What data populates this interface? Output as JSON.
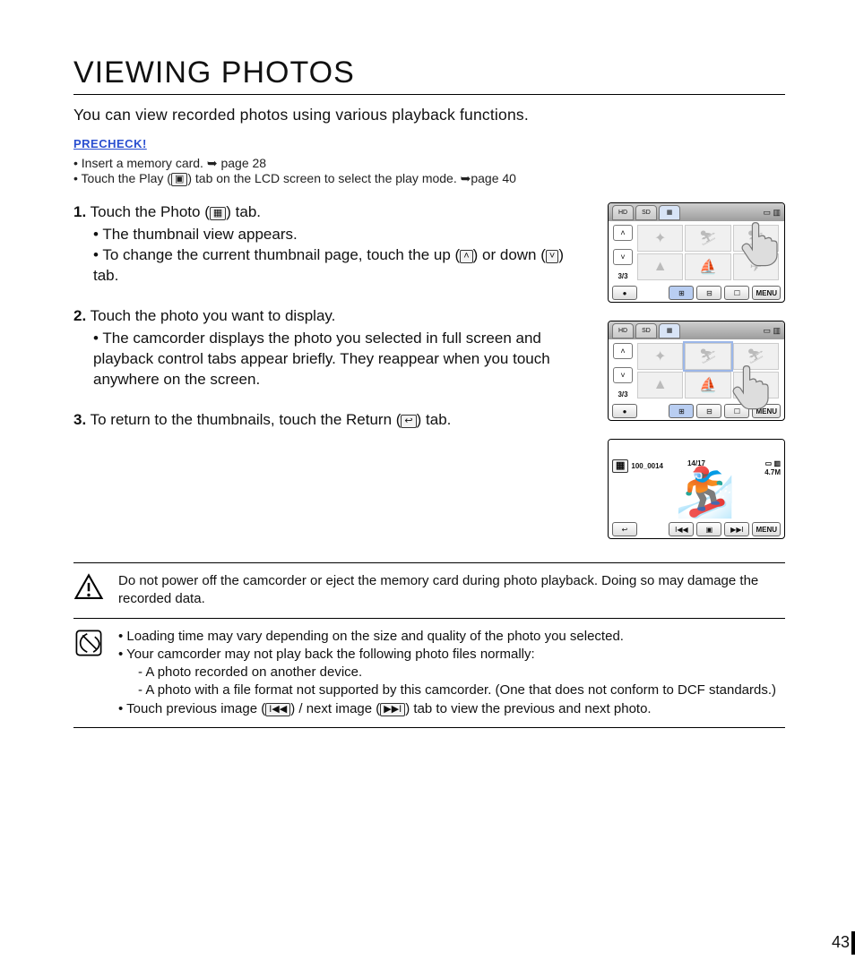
{
  "title": "VIEWING PHOTOS",
  "intro": "You can view recorded photos using various playback functions.",
  "precheck": {
    "label": "PRECHECK!",
    "items": [
      {
        "text": "Insert a memory card. ",
        "arrow": "➥",
        "ref": "page 28"
      },
      {
        "text_a": "Touch the Play (",
        "icon": "▣",
        "text_b": ") tab on the LCD screen to select the play mode. ",
        "arrow": "➥",
        "ref": "page 40"
      }
    ]
  },
  "steps": [
    {
      "num": "1.",
      "line_a": "Touch the Photo (",
      "icon": "▦",
      "line_b": ") tab.",
      "subs": [
        {
          "text": "The thumbnail view appears."
        },
        {
          "text_a": "To change the current thumbnail page, touch the up (",
          "icon1": "˄",
          "text_b": ") or down (",
          "icon2": "˅",
          "text_c": ") tab."
        }
      ]
    },
    {
      "num": "2.",
      "line": "Touch the photo you want to display.",
      "subs": [
        {
          "text": "The camcorder displays the photo you selected in full screen and playback control tabs appear briefly. They reappear when you touch anywhere on the screen."
        }
      ]
    },
    {
      "num": "3.",
      "line_a": "To return to the thumbnails, touch the Return (",
      "icon": "↩",
      "line_b": ") tab."
    }
  ],
  "lcd": {
    "tabs": {
      "hd": "HD",
      "sd": "SD"
    },
    "page_indicator": "3/3",
    "menu": "MENU",
    "full": {
      "file": "100_0014",
      "counter": "14/17",
      "size": "4.7M"
    },
    "nav": {
      "up": "˄",
      "down": "˅"
    },
    "bottom": {
      "grid3": "⊞",
      "grid4": "⊟",
      "date": "☐",
      "rec": "●"
    },
    "play": {
      "back": "↩",
      "prev": "I◀◀",
      "slide": "▣",
      "next": "▶▶I"
    }
  },
  "warning": "Do not power off the camcorder or eject the memory card during photo playback. Doing so may damage the recorded data.",
  "notes": {
    "n1": "Loading time may vary depending on the size and quality of the photo you selected.",
    "n2": "Your camcorder may not play back the following photo files normally:",
    "n2a": "A photo recorded on another device.",
    "n2b": "A photo with a file format not supported by this camcorder. (One that does not conform to DCF standards.)",
    "n3_a": "Touch previous image (",
    "n3_icon1": "I◀◀",
    "n3_b": ") / next image (",
    "n3_icon2": "▶▶I",
    "n3_c": ") tab to view the previous and next photo."
  },
  "page_number": "43"
}
